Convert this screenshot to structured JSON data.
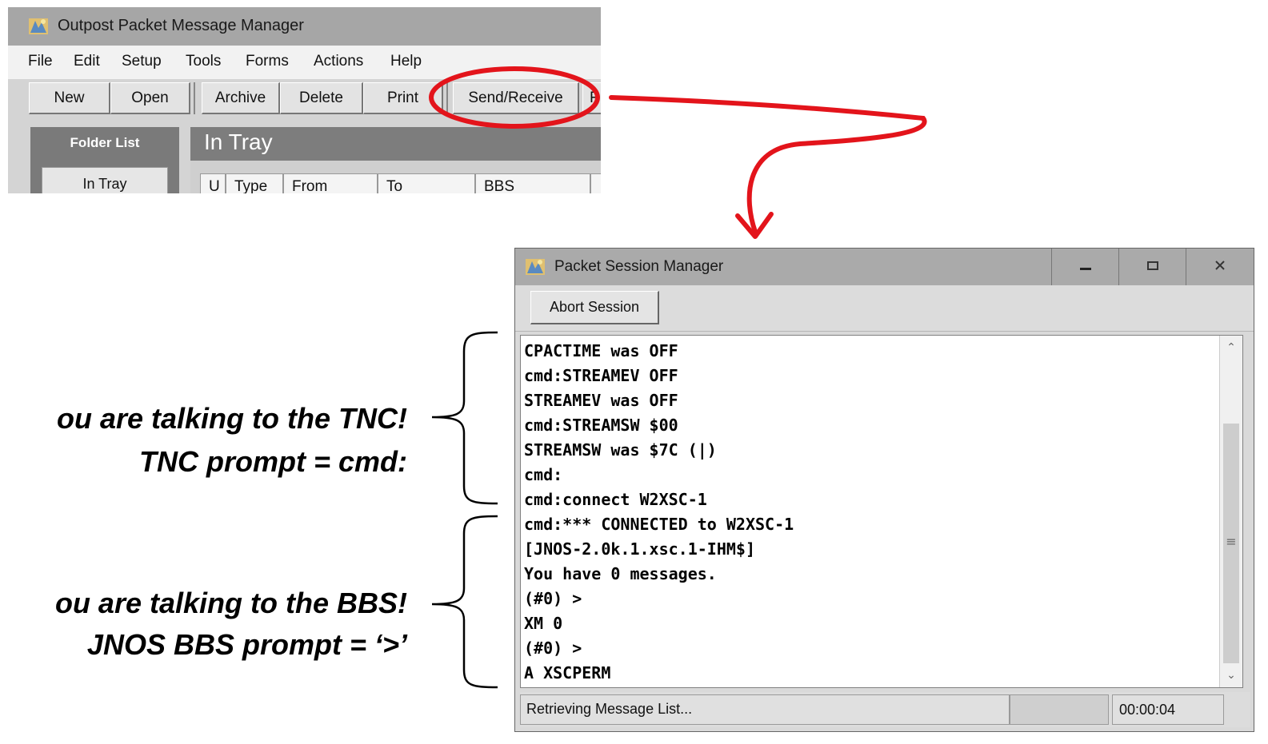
{
  "outpost": {
    "title": "Outpost Packet Message Manager",
    "menu": [
      "File",
      "Edit",
      "Setup",
      "Tools",
      "Forms",
      "Actions",
      "Help"
    ],
    "toolbar": {
      "new": "New",
      "open": "Open",
      "archive": "Archive",
      "delete": "Delete",
      "print": "Print",
      "send_receive": "Send/Receive",
      "cut_off": "F"
    },
    "folder_list": {
      "header": "Folder List",
      "in_tray": "In Tray"
    },
    "main": {
      "header": "In Tray",
      "columns": [
        "U",
        "Type",
        "From",
        "To",
        "BBS"
      ]
    }
  },
  "session_manager": {
    "title": "Packet Session Manager",
    "abort_label": "Abort Session",
    "terminal_lines": [
      "CPACTIME was OFF",
      "cmd:STREAMEV OFF",
      "STREAMEV was OFF",
      "cmd:STREAMSW $00",
      "STREAMSW was $7C (|)",
      "cmd:",
      "cmd:connect W2XSC-1",
      "cmd:*** CONNECTED to W2XSC-1",
      "[JNOS-2.0k.1.xsc.1-IHM$]",
      "You have 0 messages.",
      "(#0) >",
      "XM 0",
      "(#0) >",
      "A XSCPERM"
    ],
    "status_text": "Retrieving Message List...",
    "elapsed": "00:00:04"
  },
  "annotations": {
    "tnc_line1": "ou are talking to the TNC!",
    "tnc_line2": "TNC prompt = cmd:",
    "bbs_line1": "ou are talking to the BBS!",
    "bbs_line2": "JNOS BBS prompt = ‘>’"
  },
  "colors": {
    "highlight": "#e3141b",
    "titlebar": "#a6a6a6"
  }
}
